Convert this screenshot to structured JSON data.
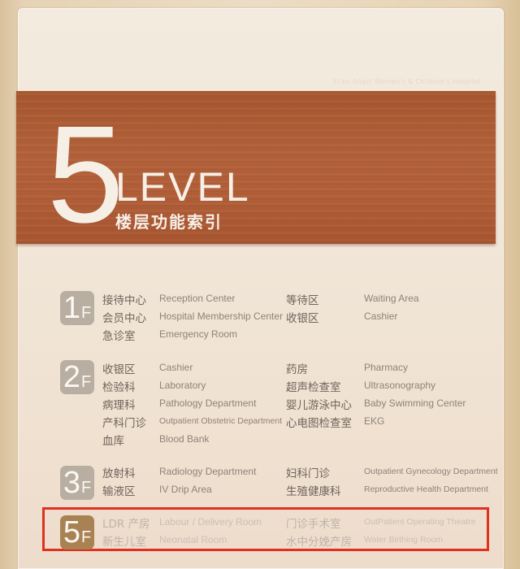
{
  "sign": {
    "hospital_name": "Xi'an Angel Women's & Children's Hospital",
    "level_number": "5",
    "level_word": "LEVEL",
    "level_subtitle": "楼层功能索引",
    "highlight_color": "#e0301e",
    "wood_color": "#b35f38"
  },
  "floors": [
    {
      "number": "1",
      "suffix": "F",
      "highlighted": false,
      "left": [
        {
          "cn": "接待中心",
          "en": "Reception Center"
        },
        {
          "cn": "会员中心",
          "en": "Hospital Membership Center"
        },
        {
          "cn": "急诊室",
          "en": "Emergency Room"
        }
      ],
      "right": [
        {
          "cn": "等待区",
          "en": "Waiting Area"
        },
        {
          "cn": "收银区",
          "en": "Cashier"
        }
      ]
    },
    {
      "number": "2",
      "suffix": "F",
      "highlighted": false,
      "left": [
        {
          "cn": "收银区",
          "en": "Cashier"
        },
        {
          "cn": "检验科",
          "en": "Laboratory"
        },
        {
          "cn": "病理科",
          "en": "Pathology Department"
        },
        {
          "cn": "产科门诊",
          "en": "Outpatient Obstetric Department"
        },
        {
          "cn": "血库",
          "en": "Blood Bank"
        }
      ],
      "right": [
        {
          "cn": "药房",
          "en": "Pharmacy"
        },
        {
          "cn": "超声检查室",
          "en": "Ultrasonography"
        },
        {
          "cn": "婴儿游泳中心",
          "en": "Baby Swimming Center"
        },
        {
          "cn": "心电图检查室",
          "en": "EKG"
        }
      ]
    },
    {
      "number": "3",
      "suffix": "F",
      "highlighted": false,
      "left": [
        {
          "cn": "放射科",
          "en": "Radiology Department"
        },
        {
          "cn": "输液区",
          "en": "IV Drip Area"
        }
      ],
      "right": [
        {
          "cn": "妇科门诊",
          "en": "Outpatient Gynecology Department"
        },
        {
          "cn": "生殖健康科",
          "en": "Reproductive Health Department"
        }
      ]
    },
    {
      "number": "5",
      "suffix": "F",
      "highlighted": true,
      "left": [
        {
          "cn": "LDR 产房",
          "en": "Labour / Delivery Room"
        },
        {
          "cn": "新生儿室",
          "en": "Neonatal Room"
        }
      ],
      "right": [
        {
          "cn": "门诊手术室",
          "en": "OutPatient Operating Theatre"
        },
        {
          "cn": "水中分娩产房",
          "en": "Water Birthing Room"
        }
      ]
    }
  ]
}
